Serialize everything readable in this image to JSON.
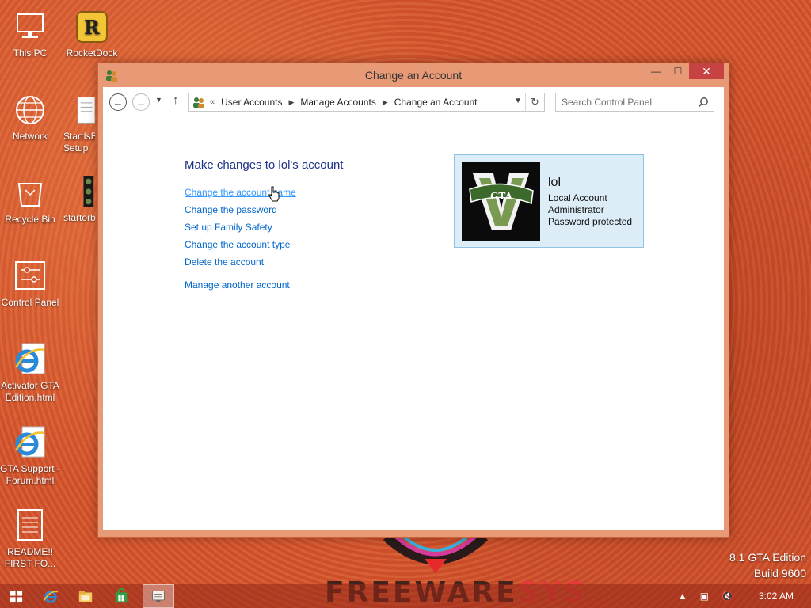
{
  "desktop": {
    "icons": [
      {
        "label": "This PC"
      },
      {
        "label": "RocketDock"
      },
      {
        "label": "Network"
      },
      {
        "label": "StartIsBack Setup"
      },
      {
        "label": "Recycle Bin"
      },
      {
        "label": "startorb"
      },
      {
        "label": "Control Panel"
      },
      {
        "label": "Activator GTA Edition.html"
      },
      {
        "label": "GTA Support - Forum.html"
      },
      {
        "label": "README!! FIRST FO..."
      }
    ],
    "watermark": {
      "main": "FREEWARE",
      "accent": "SYS"
    },
    "build_line1": "8.1 GTA Edition",
    "build_line2": "Build 9600"
  },
  "window": {
    "title": "Change an Account",
    "controls": {
      "minimize": "—",
      "maximize": "☐",
      "close": "✕"
    },
    "nav": {
      "back_icon": "back-arrow-icon",
      "forward_icon": "forward-arrow-icon",
      "up_icon": "up-arrow-icon",
      "breadcrumb_prefix": "«",
      "breadcrumbs": [
        "User Accounts",
        "Manage Accounts",
        "Change an Account"
      ],
      "search_placeholder": "Search Control Panel"
    },
    "heading": "Make changes to lol's account",
    "links": [
      "Change the account name",
      "Change the password",
      "Set up Family Safety",
      "Change the account type",
      "Delete the account"
    ],
    "manage_link": "Manage another account",
    "account": {
      "name": "lol",
      "type": "Local Account",
      "role": "Administrator",
      "status": "Password protected",
      "avatar_text": "GTA"
    }
  },
  "taskbar": {
    "clock": "3:02 AM",
    "items": [
      "start-icon",
      "internet-explorer-icon",
      "file-explorer-icon",
      "store-icon",
      "control-panel-icon"
    ]
  }
}
